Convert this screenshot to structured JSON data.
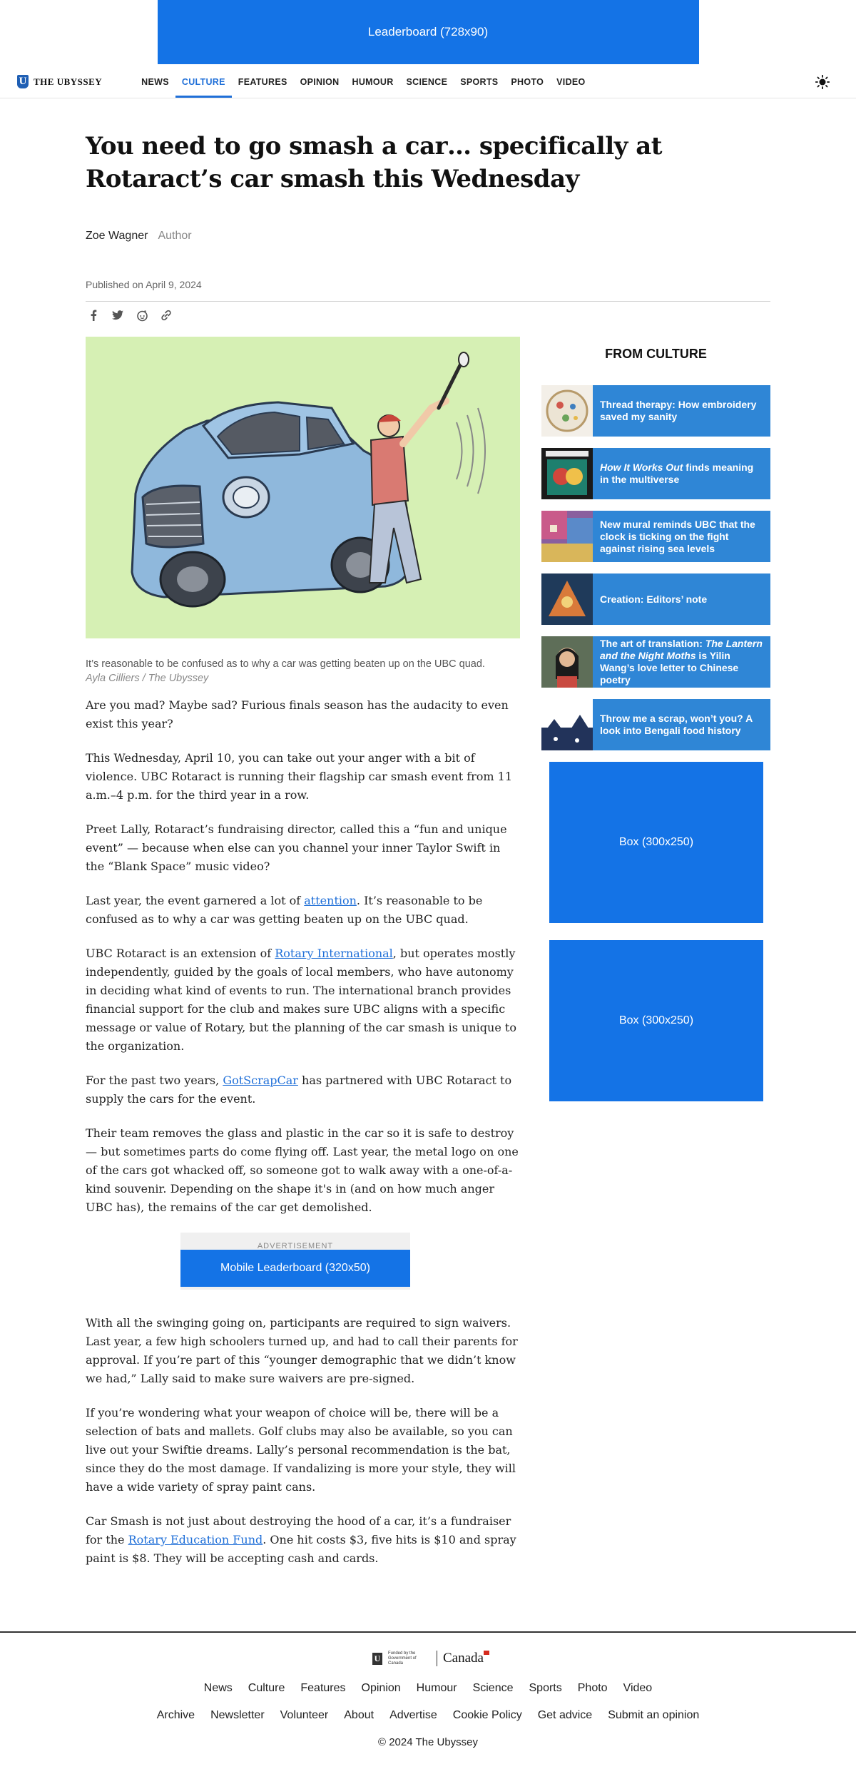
{
  "ads": {
    "top": "Leaderboard (728x90)",
    "inline_label": "ADVERTISEMENT",
    "inline": "Mobile Leaderboard (320x50)",
    "sidebar_1": "Box (300x250)",
    "sidebar_2": "Box (300x250)"
  },
  "nav": {
    "logo_text": "THE UBYSSEY",
    "links": [
      "NEWS",
      "CULTURE",
      "FEATURES",
      "OPINION",
      "HUMOUR",
      "SCIENCE",
      "SPORTS",
      "PHOTO",
      "VIDEO"
    ],
    "active": "CULTURE"
  },
  "article": {
    "headline": "You need to go smash a car… specifically at Rotaract’s car smash this Wednesday",
    "author_name": "Zoe Wagner",
    "author_role": "Author",
    "published": "Published on April 9, 2024",
    "caption": "It’s reasonable to be confused as to why a car was getting beaten up on the UBC quad.",
    "caption_credit": "Ayla Cilliers / The Ubyssey",
    "p1": "Are you mad? Maybe sad? Furious finals season has the audacity to even exist this year?",
    "p2": "This Wednesday, April 10, you can take out your anger with a bit of violence. UBC Rotaract is running their flagship car smash event from 11 a.m.–4 p.m. for the third year in a row.",
    "p3": "Preet Lally, Rotaract’s fundraising director, called this a “fun and unique event” — because when else can you channel your inner Taylor Swift in the “Blank Space” music video?",
    "p4_a": "Last year, the event garnered a lot of ",
    "p4_link": "attention",
    "p4_b": ". It’s reasonable to be confused as to why a car was getting beaten up on the UBC quad.",
    "p5_a": "UBC Rotaract is an extension of ",
    "p5_link": "Rotary International",
    "p5_b": ", but operates mostly independently, guided by the goals of local members, who have autonomy in deciding what kind of events to run. The international branch provides financial support for the club and makes sure UBC aligns with a specific message or value of Rotary, but the planning of the car smash is unique to the organization.",
    "p6_a": "For the past two years, ",
    "p6_link": "GotScrapCar",
    "p6_b": " has partnered with UBC Rotaract to supply the cars for the event.",
    "p7": "Their team removes the glass and plastic in the car so it is safe to destroy — but sometimes parts do come flying off. Last year, the metal logo on one of the cars got whacked off, so someone got to walk away with a one-of-a-kind souvenir. Depending on the shape it's in (and on how much anger UBC has), the remains of the car get demolished.",
    "p8": "With all the swinging going on, participants are required to sign waivers. Last year, a few high schoolers turned up, and had to call their parents for approval. If you’re part of this “younger demographic that we didn’t know we had,” Lally said to make sure waivers are pre-signed.",
    "p9": "If you’re wondering what your weapon of choice will be, there will be a selection of bats and mallets. Golf clubs may also be available, so you can live out your Swiftie dreams. Lally’s personal recommendation is the bat, since they do the most damage. If vandalizing is more your style, they will have a wide variety of spray paint cans.",
    "p10_a": "Car Smash is not just about destroying the hood of a car, it’s a fundraiser for the ",
    "p10_link": "Rotary Education Fund",
    "p10_b": ". One hit costs $3, five hits is $10 and spray paint is $8. They will be accepting cash and cards."
  },
  "sidebar": {
    "title": "FROM CULTURE",
    "items": [
      {
        "title": "Thread therapy: How embroidery saved my sanity"
      },
      {
        "title_italic": "How It Works Out",
        "title": " finds meaning in the multiverse"
      },
      {
        "title": "New mural reminds UBC that the clock is ticking on the fight against rising sea levels"
      },
      {
        "title": "Creation: Editors’ note"
      },
      {
        "title_a": "The art of translation: ",
        "title_italic": "The Lantern and the Night Moths",
        "title_b": " is Yilin Wang’s love letter to Chinese poetry"
      },
      {
        "title": "Throw me a scrap, won’t you? A look into Bengali food history"
      }
    ]
  },
  "footer": {
    "funding_text": "Funded by the Government of Canada",
    "canada": "Canada",
    "links_row1": [
      "News",
      "Culture",
      "Features",
      "Opinion",
      "Humour",
      "Science",
      "Sports",
      "Photo",
      "Video"
    ],
    "links_row2": [
      "Archive",
      "Newsletter",
      "Volunteer",
      "About",
      "Advertise",
      "Cookie Policy",
      "Get advice",
      "Submit an opinion"
    ],
    "copyright": "© 2024 The Ubyssey"
  },
  "colors": {
    "accent": "#1f6fd8",
    "ad_blue": "#1473e6",
    "sidebar_blue": "#2f86d6"
  }
}
